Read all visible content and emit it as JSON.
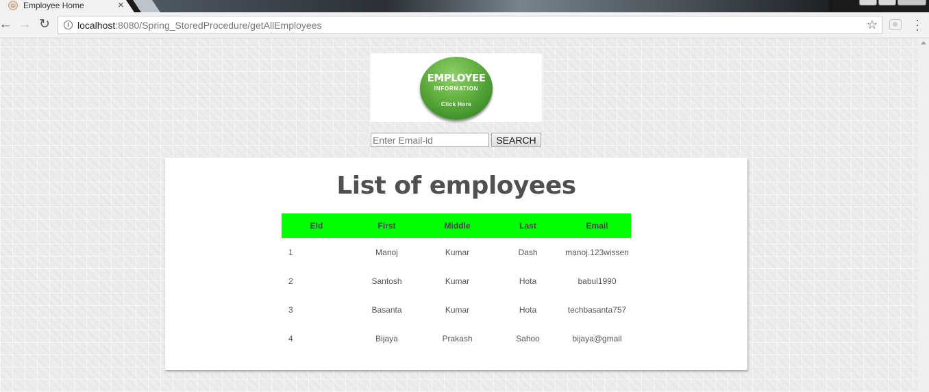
{
  "browser": {
    "tab_title": "Employee Home",
    "tab_close_glyph": "×",
    "url_host": "localhost",
    "url_rest": ":8080/Spring_StoredProcedure/getAllEmployees",
    "icons": [
      "back-arrow-icon",
      "forward-arrow-icon",
      "reload-icon",
      "info-icon",
      "star-icon",
      "extension-icon",
      "menu-icon"
    ]
  },
  "logo": {
    "line1": "EMPLOYEE",
    "line2": "INFORMATION",
    "line3": "Click Here",
    "color": "#5fae3e"
  },
  "search": {
    "placeholder": "Enter Email-id",
    "value": "",
    "button_label": "SEARCH"
  },
  "main": {
    "title": "List of employees",
    "header_color": "#00ff00",
    "columns": [
      "EId",
      "First",
      "Middle",
      "Last",
      "Email"
    ],
    "rows": [
      [
        "1",
        "Manoj",
        "Kumar",
        "Dash",
        "manoj.123wissen"
      ],
      [
        "2",
        "Santosh",
        "Kumar",
        "Hota",
        "babul1990"
      ],
      [
        "3",
        "Basanta",
        "Kumar",
        "Hota",
        "techbasanta757"
      ],
      [
        "4",
        "Bijaya",
        "Prakash",
        "Sahoo",
        "bijaya@gmail"
      ]
    ]
  }
}
